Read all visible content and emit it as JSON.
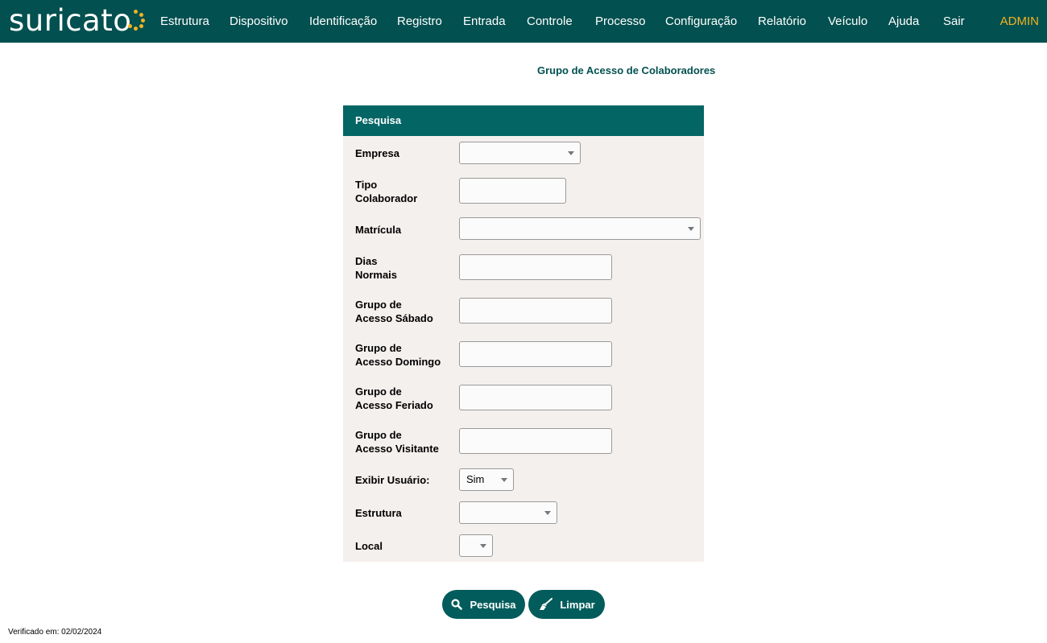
{
  "brand": {
    "name": "suricato",
    "dot_color": "#f2b320"
  },
  "nav": {
    "items": [
      "Estrutura",
      "Dispositivo",
      "Identificação",
      "Registro",
      "Entrada",
      "Controle",
      "Processo",
      "Configuração",
      "Relatório",
      "Veículo",
      "Ajuda",
      "Sair"
    ],
    "user": "ADMIN"
  },
  "page": {
    "title": "Grupo de Acesso de Colaboradores"
  },
  "panel": {
    "header": "Pesquisa",
    "fields": {
      "empresa": {
        "label": "Empresa",
        "value": ""
      },
      "tipo_colaborador": {
        "label_line1": "Tipo",
        "label_line2": "Colaborador",
        "value": ""
      },
      "matricula": {
        "label": "Matrícula",
        "value": ""
      },
      "dias_normais": {
        "label_line1": "Dias",
        "label_line2": "Normais",
        "value": ""
      },
      "grupo_sabado": {
        "label_line1": "Grupo de",
        "label_line2": "Acesso Sábado",
        "value": ""
      },
      "grupo_domingo": {
        "label_line1": "Grupo de",
        "label_line2": "Acesso Domingo",
        "value": ""
      },
      "grupo_feriado": {
        "label_line1": "Grupo de",
        "label_line2": "Acesso Feriado",
        "value": ""
      },
      "grupo_visitante": {
        "label_line1": "Grupo de",
        "label_line2": "Acesso Visitante",
        "value": ""
      },
      "exibir_usuario": {
        "label": "Exibir Usuário:",
        "value": "Sim"
      },
      "estrutura": {
        "label": "Estrutura",
        "value": ""
      },
      "local": {
        "label": "Local",
        "value": ""
      }
    }
  },
  "actions": {
    "search": "Pesquisa",
    "clear": "Limpar"
  },
  "footer": {
    "verified": "Verificado em: 02/02/2024"
  },
  "colors": {
    "nav_bg": "#035050",
    "panel_header": "#046565",
    "panel_bg": "#f4f0ee",
    "accent": "#f2b320",
    "button": "#035c5c"
  }
}
